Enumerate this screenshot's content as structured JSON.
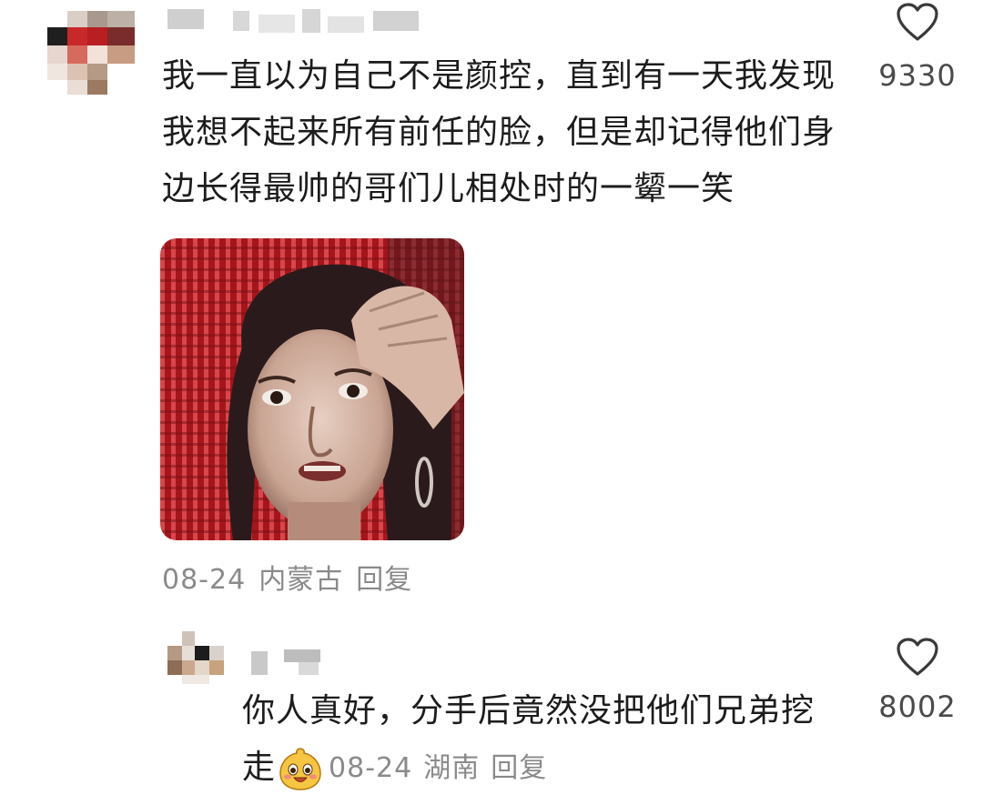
{
  "comments": [
    {
      "text": "我一直以为自己不是颜控，直到有一天我发现我想不起来所有前任的脸，但是却记得他们身边长得最帅的哥们儿相处时的一颦一笑",
      "date": "08-24",
      "location": "内蒙古",
      "reply_label": "回复",
      "like_count": "9330",
      "icons": {
        "like": "heart-outline-icon"
      }
    },
    {
      "text": "你人真好，分手后竟然没把他们兄弟挖走",
      "emoji": "smiling-face-emoji",
      "date": "08-24",
      "location": "湖南",
      "reply_label": "回复",
      "like_count": "8002",
      "icons": {
        "like": "heart-outline-icon"
      }
    }
  ],
  "colors": {
    "meta_text": "#8a8a8a",
    "body_text": "#1c1c1c",
    "like_count": "#4a4a4a"
  }
}
